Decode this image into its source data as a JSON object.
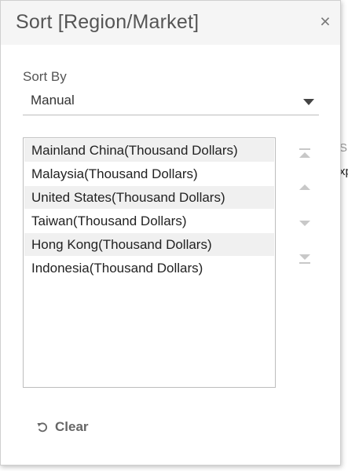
{
  "background": {
    "fragment_1": "SM",
    "fragment_2": "xp"
  },
  "dialog": {
    "title": "Sort [Region/Market]",
    "close_label": "×",
    "sort_by_label": "Sort By",
    "sort_by_value": "Manual",
    "items": [
      "Mainland China(Thousand Dollars)",
      "Malaysia(Thousand Dollars)",
      "United States(Thousand Dollars)",
      "Taiwan(Thousand Dollars)",
      "Hong Kong(Thousand Dollars)",
      "Indonesia(Thousand Dollars)"
    ],
    "controls": [
      "move-to-top-icon",
      "move-up-icon",
      "move-down-icon",
      "move-to-bottom-icon"
    ],
    "clear_label": "Clear"
  },
  "colors": {
    "header_bg": "#f5f5f5",
    "alt_row_bg": "#f0f0f0",
    "control_icon": "#c8c8c8",
    "clear_text": "#666666"
  }
}
